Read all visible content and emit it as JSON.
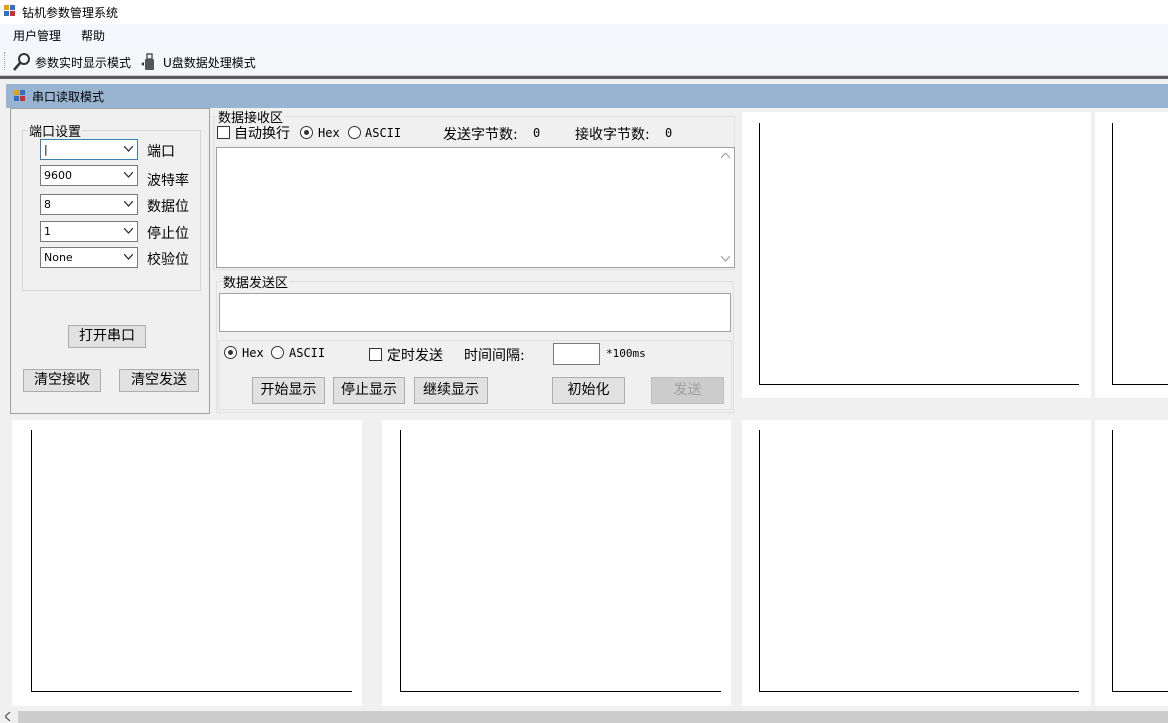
{
  "window": {
    "title": "钻机参数管理系统"
  },
  "menu": {
    "items": [
      "用户管理",
      "帮助"
    ]
  },
  "toolbar": {
    "realtime_label": "参数实时显示模式",
    "udisk_label": "U盘数据处理模式"
  },
  "child_window": {
    "title": "串口读取模式"
  },
  "port_settings": {
    "group_label": "端口设置",
    "port": {
      "value": "|",
      "label": "端口"
    },
    "baud": {
      "value": "9600",
      "label": "波特率"
    },
    "databits": {
      "value": "8",
      "label": "数据位"
    },
    "stopbits": {
      "value": "1",
      "label": "停止位"
    },
    "parity": {
      "value": "None",
      "label": "校验位"
    },
    "open_button": "打开串口",
    "clear_receive_button": "清空接收",
    "clear_send_button": "清空发送"
  },
  "receive": {
    "group_label": "数据接收区",
    "auto_newline_label": "自动换行",
    "auto_newline_checked": false,
    "hex_label": "Hex",
    "ascii_label": "ASCII",
    "mode": "Hex",
    "sent_bytes_label": "发送字节数:",
    "sent_bytes_value": "0",
    "recv_bytes_label": "接收字节数:",
    "recv_bytes_value": "0",
    "content": ""
  },
  "send": {
    "group_label": "数据发送区",
    "content": "",
    "hex_label": "Hex",
    "ascii_label": "ASCII",
    "mode": "Hex",
    "timed_send_label": "定时发送",
    "timed_send_checked": false,
    "interval_label": "时间间隔:",
    "interval_value": "",
    "interval_unit": "*100ms",
    "start_display_button": "开始显示",
    "stop_display_button": "停止显示",
    "continue_display_button": "继续显示",
    "init_button": "初始化",
    "send_button": "发送"
  },
  "colors": {
    "mdi_title_bg": "#99b4d1",
    "chart_bg": "#ffffff",
    "axis": "#000000"
  }
}
